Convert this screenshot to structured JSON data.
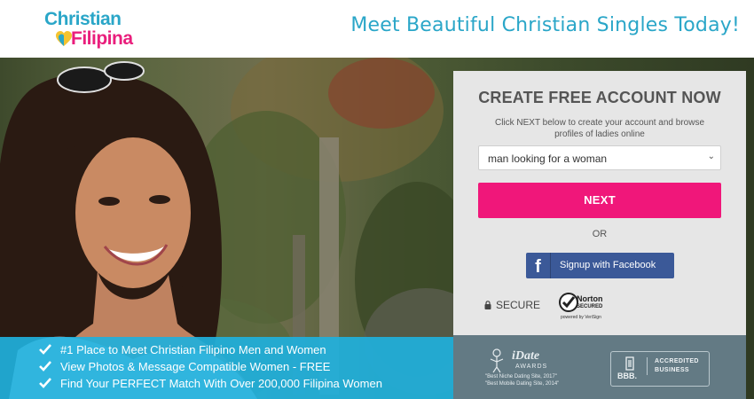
{
  "header": {
    "logo_top": "Christian",
    "logo_bottom": "Filipina",
    "tagline": "Meet Beautiful Christian Singles Today!"
  },
  "signup": {
    "title": "CREATE FREE ACCOUNT NOW",
    "subtitle": "Click NEXT below to create your account and browse profiles of ladies online",
    "select_value": "man looking for a woman",
    "next_label": "NEXT",
    "or_label": "OR",
    "facebook_label": "Signup with Facebook",
    "secure_label": "SECURE",
    "norton": {
      "label": "Norton",
      "secured": "SECURED",
      "powered": "powered by VeriSign"
    }
  },
  "badges": {
    "idate": {
      "title": "iDate",
      "awards": "AWARDS",
      "line1": "\"Best Niche Dating Site, 2017\"",
      "line2": "\"Best Mobile Dating Site, 2014\""
    },
    "bbb": {
      "label": "BBB.",
      "accredited": "ACCREDITED",
      "business": "BUSINESS"
    }
  },
  "features": [
    "#1 Place to Meet Christian Filipino Men and Women",
    "View Photos & Message Compatible Women - FREE",
    "Find Your PERFECT Match With Over 200,000 Filipina Women"
  ],
  "colors": {
    "brand_blue": "#2aa6c8",
    "brand_pink": "#e91e7c",
    "next_button": "#f0177a",
    "facebook": "#3b5998",
    "features_bar": "#20b0dc"
  }
}
